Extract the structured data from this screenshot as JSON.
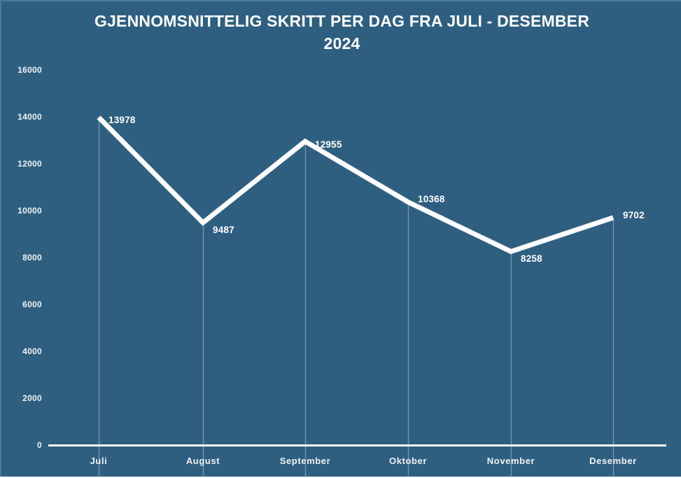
{
  "chart_data": {
    "type": "line",
    "title": "GJENNOMSNITTELIG SKRITT PER DAG FRA JULI - DESEMBER\n2024",
    "title_line1": "GJENNOMSNITTELIG SKRITT PER DAG FRA JULI - DESEMBER",
    "title_line2": "2024",
    "categories": [
      "Juli",
      "August",
      "September",
      "Oktober",
      "November",
      "Desember"
    ],
    "values": [
      13978,
      9487,
      12955,
      10368,
      8258,
      9702
    ],
    "data_labels": [
      "13978",
      "9487",
      "12955",
      "10368",
      "8258",
      "9702"
    ],
    "xlabel": "",
    "ylabel": "",
    "ylim": [
      0,
      16000
    ],
    "ytick_step": 2000,
    "ytick_labels": [
      "16000",
      "14000",
      "12000",
      "10000",
      "8000",
      "6000",
      "4000",
      "2000",
      "0"
    ],
    "ytick_values": [
      16000,
      14000,
      12000,
      10000,
      8000,
      6000,
      4000,
      2000,
      0
    ],
    "grid": false,
    "droplines": true,
    "legend": null,
    "series": [
      {
        "name": "Gjennomsnittelig skritt per dag",
        "values": [
          13978,
          9487,
          12955,
          10368,
          8258,
          9702
        ]
      }
    ],
    "colors": {
      "background": "#2E5F80",
      "line": "#FFFFFF",
      "axis": "#FFFFFF",
      "text": "#FFFFFF",
      "dropline": "#AFC2CF",
      "border": "#4D7896"
    }
  }
}
